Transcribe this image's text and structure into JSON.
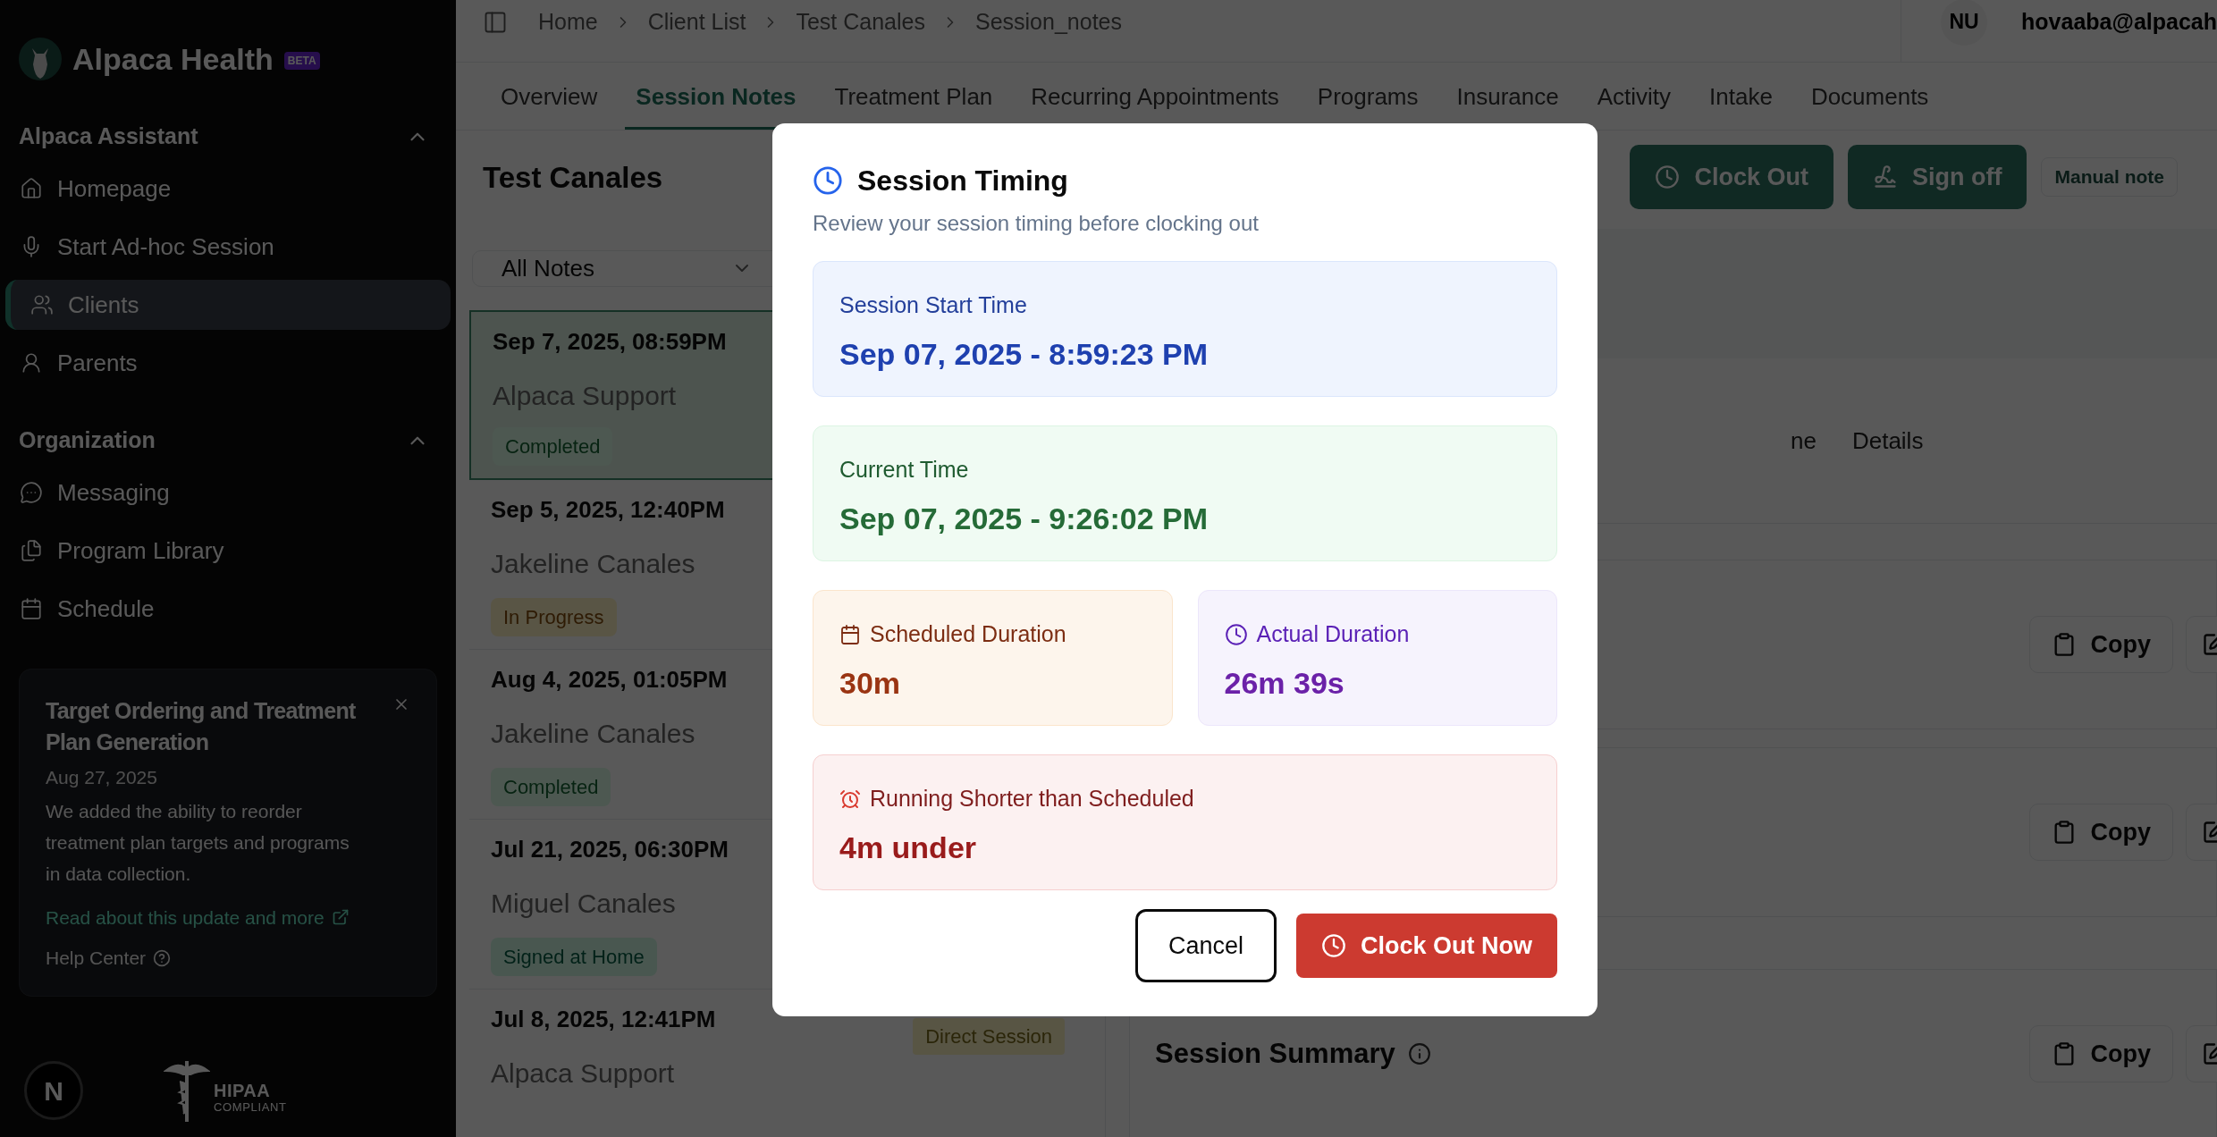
{
  "sidebar": {
    "brand": "Alpaca Health",
    "badge": "BETA",
    "sections": [
      {
        "title": "Alpaca Assistant",
        "expanded": true,
        "items": [
          {
            "label": "Homepage",
            "selected": false
          },
          {
            "label": "Start Ad-hoc Session",
            "selected": false
          },
          {
            "label": "Clients",
            "selected": true
          },
          {
            "label": "Parents",
            "selected": false
          }
        ]
      },
      {
        "title": "Organization",
        "expanded": true,
        "items": [
          {
            "label": "Messaging",
            "selected": false
          },
          {
            "label": "Program Library",
            "selected": false
          },
          {
            "label": "Schedule",
            "selected": false
          }
        ]
      }
    ],
    "announcement": {
      "title": "Target Ordering and Treatment Plan Generation",
      "date": "Aug 27, 2025",
      "body": "We added the ability to reorder treatment plan targets and programs in data collection.",
      "link": "Read about this update and more",
      "help": "Help Center"
    },
    "hipaa": {
      "title": "HIPAA",
      "subtitle": "COMPLIANT"
    },
    "dev_badge": "N"
  },
  "header": {
    "breadcrumb": [
      "Home",
      "Client List",
      "Test Canales",
      "Session_notes"
    ],
    "avatar": "NU",
    "email": "hovaaba@alpacah"
  },
  "tabs": [
    {
      "label": "Overview",
      "selected": false
    },
    {
      "label": "Session Notes",
      "selected": true
    },
    {
      "label": "Treatment Plan",
      "selected": false
    },
    {
      "label": "Recurring Appointments",
      "selected": false
    },
    {
      "label": "Programs",
      "selected": false
    },
    {
      "label": "Insurance",
      "selected": false
    },
    {
      "label": "Activity",
      "selected": false
    },
    {
      "label": "Intake",
      "selected": false
    },
    {
      "label": "Documents",
      "selected": false
    }
  ],
  "notes_panel": {
    "title": "Test Canales",
    "filter": "All Notes",
    "notes": [
      {
        "date": "Sep 7, 2025, 08:59PM",
        "author": "Alpaca Support",
        "status": {
          "label": "Completed",
          "kind": "completed"
        },
        "selected": true
      },
      {
        "date": "Sep 5, 2025, 12:40PM",
        "author": "Jakeline Canales",
        "status": {
          "label": "In Progress",
          "kind": "progress"
        },
        "selected": false
      },
      {
        "date": "Aug 4, 2025, 01:05PM",
        "author": "Jakeline Canales",
        "status": {
          "label": "Completed",
          "kind": "completed"
        },
        "selected": false
      },
      {
        "date": "Jul 21, 2025, 06:30PM",
        "author": "Miguel Canales",
        "status": {
          "label": "Signed at Home",
          "kind": "signed"
        },
        "selected": false
      },
      {
        "date": "Jul 8, 2025, 12:41PM",
        "author": "Alpaca Support",
        "type": "Direct Session",
        "selected": false
      }
    ]
  },
  "detail": {
    "actions": [
      {
        "label": "Clock Out",
        "kind": "clock"
      },
      {
        "label": "Sign off",
        "kind": "sign"
      },
      {
        "label": "Manual note",
        "kind": "outline"
      }
    ],
    "subtabs": [
      {
        "label": "ne",
        "selected": false
      },
      {
        "label": "Details",
        "selected": false
      }
    ],
    "sections": [
      {
        "copy": "Copy"
      },
      {
        "copy": "Copy"
      },
      {
        "title": "Session Summary",
        "copy": "Copy"
      }
    ]
  },
  "dialog": {
    "title": "Session Timing",
    "subtitle": "Review your session timing before clocking out",
    "cards": [
      {
        "kind": "start",
        "label": "Session Start Time",
        "value": "Sep 07, 2025 - 8:59:23 PM"
      },
      {
        "kind": "current",
        "label": "Current Time",
        "value": "Sep 07, 2025 - 9:26:02 PM"
      },
      {
        "kind": "scheduled",
        "label": "Scheduled Duration",
        "value": "30m"
      },
      {
        "kind": "actual",
        "label": "Actual Duration",
        "value": "26m 39s"
      },
      {
        "kind": "difference",
        "label": "Running Shorter than Scheduled",
        "value": "4m under"
      }
    ],
    "buttons": [
      {
        "label": "Cancel",
        "kind": "secondary"
      },
      {
        "label": "Clock Out Now",
        "kind": "primary"
      }
    ]
  }
}
